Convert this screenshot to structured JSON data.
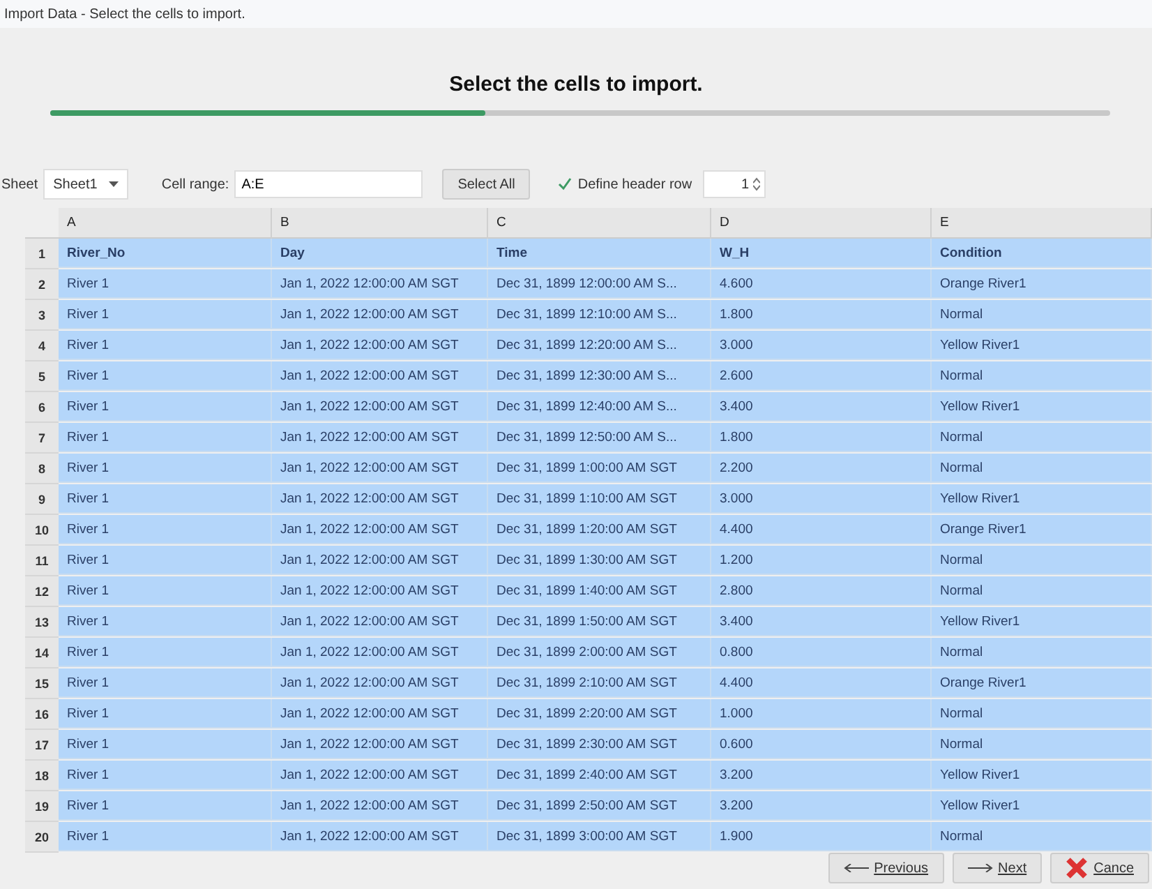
{
  "window": {
    "title": "Import Data - Select the cells to import."
  },
  "heading": "Select the cells to import.",
  "progress": {
    "level": 0.41
  },
  "toolbar": {
    "sheet_label": "Sheet",
    "sheet_value": "Sheet1",
    "range_label": "Cell range:",
    "range_value": "A:E",
    "select_all": "Select All",
    "header_row": {
      "label": "Define header row",
      "checked": true,
      "value": "1"
    }
  },
  "table": {
    "columns": [
      "A",
      "B",
      "C",
      "D",
      "E"
    ],
    "rows": [
      {
        "number": "1",
        "kind": "header",
        "selected": true,
        "cells": [
          "River_No",
          "Day",
          "Time",
          "W_H",
          "Condition"
        ]
      },
      {
        "number": "2",
        "kind": "data",
        "selected": true,
        "cells": [
          "River 1",
          "Jan 1, 2022 12:00:00 AM SGT",
          "Dec 31, 1899 12:00:00 AM S...",
          "4.600",
          "Orange River1"
        ]
      },
      {
        "number": "3",
        "kind": "data",
        "selected": true,
        "cells": [
          "River 1",
          "Jan 1, 2022 12:00:00 AM SGT",
          "Dec 31, 1899 12:10:00 AM S...",
          "1.800",
          "Normal"
        ]
      },
      {
        "number": "4",
        "kind": "data",
        "selected": true,
        "cells": [
          "River 1",
          "Jan 1, 2022 12:00:00 AM SGT",
          "Dec 31, 1899 12:20:00 AM S...",
          "3.000",
          "Yellow River1"
        ]
      },
      {
        "number": "5",
        "kind": "data",
        "selected": true,
        "cells": [
          "River 1",
          "Jan 1, 2022 12:00:00 AM SGT",
          "Dec 31, 1899 12:30:00 AM S...",
          "2.600",
          "Normal"
        ]
      },
      {
        "number": "6",
        "kind": "data",
        "selected": true,
        "cells": [
          "River 1",
          "Jan 1, 2022 12:00:00 AM SGT",
          "Dec 31, 1899 12:40:00 AM S...",
          "3.400",
          "Yellow River1"
        ]
      },
      {
        "number": "7",
        "kind": "data",
        "selected": true,
        "cells": [
          "River 1",
          "Jan 1, 2022 12:00:00 AM SGT",
          "Dec 31, 1899 12:50:00 AM S...",
          "1.800",
          "Normal"
        ]
      },
      {
        "number": "8",
        "kind": "data",
        "selected": true,
        "cells": [
          "River 1",
          "Jan 1, 2022 12:00:00 AM SGT",
          "Dec 31, 1899 1:00:00 AM SGT",
          "2.200",
          "Normal"
        ]
      },
      {
        "number": "9",
        "kind": "data",
        "selected": true,
        "cells": [
          "River 1",
          "Jan 1, 2022 12:00:00 AM SGT",
          "Dec 31, 1899 1:10:00 AM SGT",
          "3.000",
          "Yellow River1"
        ]
      },
      {
        "number": "10",
        "kind": "data",
        "selected": true,
        "cells": [
          "River 1",
          "Jan 1, 2022 12:00:00 AM SGT",
          "Dec 31, 1899 1:20:00 AM SGT",
          "4.400",
          "Orange River1"
        ]
      },
      {
        "number": "11",
        "kind": "data",
        "selected": true,
        "cells": [
          "River 1",
          "Jan 1, 2022 12:00:00 AM SGT",
          "Dec 31, 1899 1:30:00 AM SGT",
          "1.200",
          "Normal"
        ]
      },
      {
        "number": "12",
        "kind": "data",
        "selected": true,
        "cells": [
          "River 1",
          "Jan 1, 2022 12:00:00 AM SGT",
          "Dec 31, 1899 1:40:00 AM SGT",
          "2.800",
          "Normal"
        ]
      },
      {
        "number": "13",
        "kind": "data",
        "selected": true,
        "cells": [
          "River 1",
          "Jan 1, 2022 12:00:00 AM SGT",
          "Dec 31, 1899 1:50:00 AM SGT",
          "3.400",
          "Yellow River1"
        ]
      },
      {
        "number": "14",
        "kind": "data",
        "selected": true,
        "cells": [
          "River 1",
          "Jan 1, 2022 12:00:00 AM SGT",
          "Dec 31, 1899 2:00:00 AM SGT",
          "0.800",
          "Normal"
        ]
      },
      {
        "number": "15",
        "kind": "data",
        "selected": true,
        "cells": [
          "River 1",
          "Jan 1, 2022 12:00:00 AM SGT",
          "Dec 31, 1899 2:10:00 AM SGT",
          "4.400",
          "Orange River1"
        ]
      },
      {
        "number": "16",
        "kind": "data",
        "selected": true,
        "cells": [
          "River 1",
          "Jan 1, 2022 12:00:00 AM SGT",
          "Dec 31, 1899 2:20:00 AM SGT",
          "1.000",
          "Normal"
        ]
      },
      {
        "number": "17",
        "kind": "data",
        "selected": true,
        "cells": [
          "River 1",
          "Jan 1, 2022 12:00:00 AM SGT",
          "Dec 31, 1899 2:30:00 AM SGT",
          "0.600",
          "Normal"
        ]
      },
      {
        "number": "18",
        "kind": "data",
        "selected": true,
        "cells": [
          "River 1",
          "Jan 1, 2022 12:00:00 AM SGT",
          "Dec 31, 1899 2:40:00 AM SGT",
          "3.200",
          "Yellow River1"
        ]
      },
      {
        "number": "19",
        "kind": "data",
        "selected": true,
        "cells": [
          "River 1",
          "Jan 1, 2022 12:00:00 AM SGT",
          "Dec 31, 1899 2:50:00 AM SGT",
          "3.200",
          "Yellow River1"
        ]
      },
      {
        "number": "20",
        "kind": "data",
        "selected": true,
        "cells": [
          "River 1",
          "Jan 1, 2022 12:00:00 AM SGT",
          "Dec 31, 1899 3:00:00 AM SGT",
          "1.900",
          "Normal"
        ]
      }
    ]
  },
  "buttons": [
    {
      "kind": "previous",
      "label": "Previous"
    },
    {
      "kind": "next",
      "label": "Next"
    },
    {
      "kind": "cancel",
      "label": "Cance"
    }
  ]
}
